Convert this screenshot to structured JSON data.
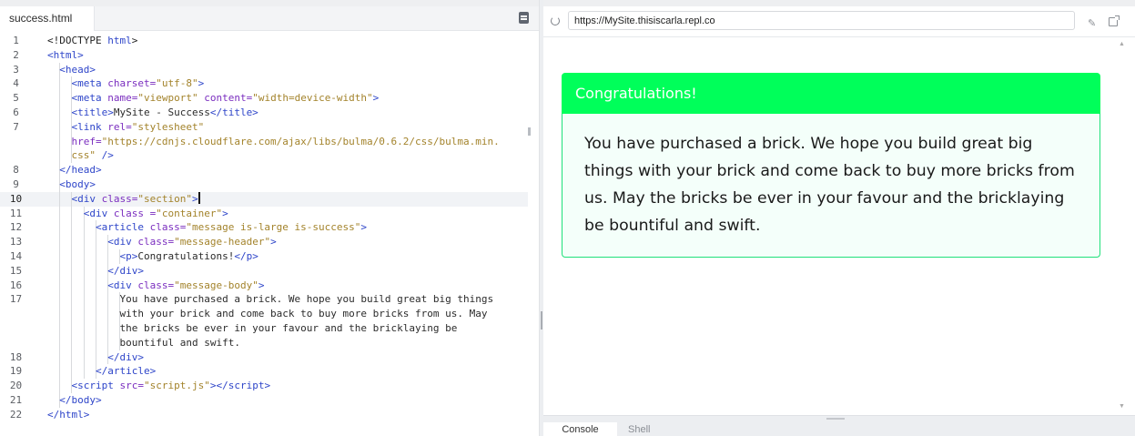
{
  "editor": {
    "tab_label": "success.html",
    "lines": [
      {
        "n": "1",
        "depth": 0,
        "html": "&lt;!DOCTYPE <span class=\"t\">html</span>&gt;"
      },
      {
        "n": "2",
        "depth": 0,
        "html": "<span class=\"t\">&lt;html&gt;</span>"
      },
      {
        "n": "3",
        "depth": 1,
        "html": "  <span class=\"t\">&lt;head&gt;</span>"
      },
      {
        "n": "4",
        "depth": 2,
        "html": "    <span class=\"t\">&lt;meta</span> <span class=\"an\">charset=</span><span class=\"av\">\"utf-8\"</span><span class=\"t\">&gt;</span>"
      },
      {
        "n": "5",
        "depth": 2,
        "html": "    <span class=\"t\">&lt;meta</span> <span class=\"an\">name=</span><span class=\"av\">\"viewport\"</span> <span class=\"an\">content=</span><span class=\"av\">\"width=device-width\"</span><span class=\"t\">&gt;</span>"
      },
      {
        "n": "6",
        "depth": 2,
        "html": "    <span class=\"t\">&lt;title&gt;</span><span class=\"dt\">MySite - Success</span><span class=\"t\">&lt;/title&gt;</span>"
      },
      {
        "n": "7",
        "depth": 2,
        "html": "    <span class=\"t\">&lt;link</span> <span class=\"an\">rel=</span><span class=\"av\">\"stylesheet\"</span>"
      },
      {
        "n": "",
        "depth": 2,
        "html": "    <span class=\"an\">href=</span><span class=\"av\">\"https://cdnjs.cloudflare.com/ajax/libs/bulma/0.6.2/css/bulma.min.</span>"
      },
      {
        "n": "",
        "depth": 2,
        "html": "    <span class=\"av\">css\"</span> <span class=\"t\">/&gt;</span>"
      },
      {
        "n": "8",
        "depth": 1,
        "html": "  <span class=\"t\">&lt;/head&gt;</span>"
      },
      {
        "n": "9",
        "depth": 1,
        "html": "  <span class=\"t\">&lt;body&gt;</span>"
      },
      {
        "n": "10",
        "depth": 2,
        "active": true,
        "html": "    <span class=\"t\">&lt;div</span> <span class=\"an\">class=</span><span class=\"av\">\"section\"</span><span class=\"t\">&gt;</span><span class=\"caret\"></span>"
      },
      {
        "n": "11",
        "depth": 3,
        "html": "      <span class=\"t\">&lt;div</span> <span class=\"an\">class =</span><span class=\"av\">\"container\"</span><span class=\"t\">&gt;</span>"
      },
      {
        "n": "12",
        "depth": 4,
        "html": "        <span class=\"t\">&lt;article</span> <span class=\"an\">class=</span><span class=\"av\">\"message is-large is-success\"</span><span class=\"t\">&gt;</span>"
      },
      {
        "n": "13",
        "depth": 5,
        "html": "          <span class=\"t\">&lt;div</span> <span class=\"an\">class=</span><span class=\"av\">\"message-header\"</span><span class=\"t\">&gt;</span>"
      },
      {
        "n": "14",
        "depth": 6,
        "html": "            <span class=\"t\">&lt;p&gt;</span><span class=\"dt\">Congratulations!</span><span class=\"t\">&lt;/p&gt;</span>"
      },
      {
        "n": "15",
        "depth": 5,
        "html": "          <span class=\"t\">&lt;/div&gt;</span>"
      },
      {
        "n": "16",
        "depth": 5,
        "html": "          <span class=\"t\">&lt;div</span> <span class=\"an\">class=</span><span class=\"av\">\"message-body\"</span><span class=\"t\">&gt;</span>"
      },
      {
        "n": "17",
        "depth": 6,
        "html": "            <span class=\"dt\">You have purchased a brick. We hope you build great big things</span>"
      },
      {
        "n": "",
        "depth": 6,
        "html": "            <span class=\"dt\">with your brick and come back to buy more bricks from us. May</span>"
      },
      {
        "n": "",
        "depth": 6,
        "html": "            <span class=\"dt\">the bricks be ever in your favour and the bricklaying be</span>"
      },
      {
        "n": "",
        "depth": 6,
        "html": "            <span class=\"dt\">bountiful and swift.</span>"
      },
      {
        "n": "18",
        "depth": 5,
        "html": "          <span class=\"t\">&lt;/div&gt;</span>"
      },
      {
        "n": "19",
        "depth": 4,
        "html": "        <span class=\"t\">&lt;/article&gt;</span>"
      },
      {
        "n": "20",
        "depth": 2,
        "html": "    <span class=\"t\">&lt;script</span> <span class=\"an\">src=</span><span class=\"av\">\"script.js\"</span><span class=\"t\">&gt;&lt;/script&gt;</span>"
      },
      {
        "n": "21",
        "depth": 1,
        "html": "  <span class=\"t\">&lt;/body&gt;</span>"
      },
      {
        "n": "22",
        "depth": 0,
        "html": "<span class=\"t\">&lt;/html&gt;</span>"
      }
    ]
  },
  "preview": {
    "url": "https://MySite.thisiscarla.repl.co",
    "message_header": "Congratulations!",
    "message_body": "You have purchased a brick. We hope you build great big things with your brick and come back to buy more bricks from us. May the bricks be ever in your favour and the bricklaying be bountiful and swift.",
    "tabs": [
      "Console",
      "Shell"
    ]
  },
  "colors": {
    "header_green": "#00ff5a",
    "body_bg": "#f4fffa",
    "tag_blue": "#2e45c9",
    "attr_purple": "#7a2dbf",
    "value_gold": "#a3832b"
  }
}
